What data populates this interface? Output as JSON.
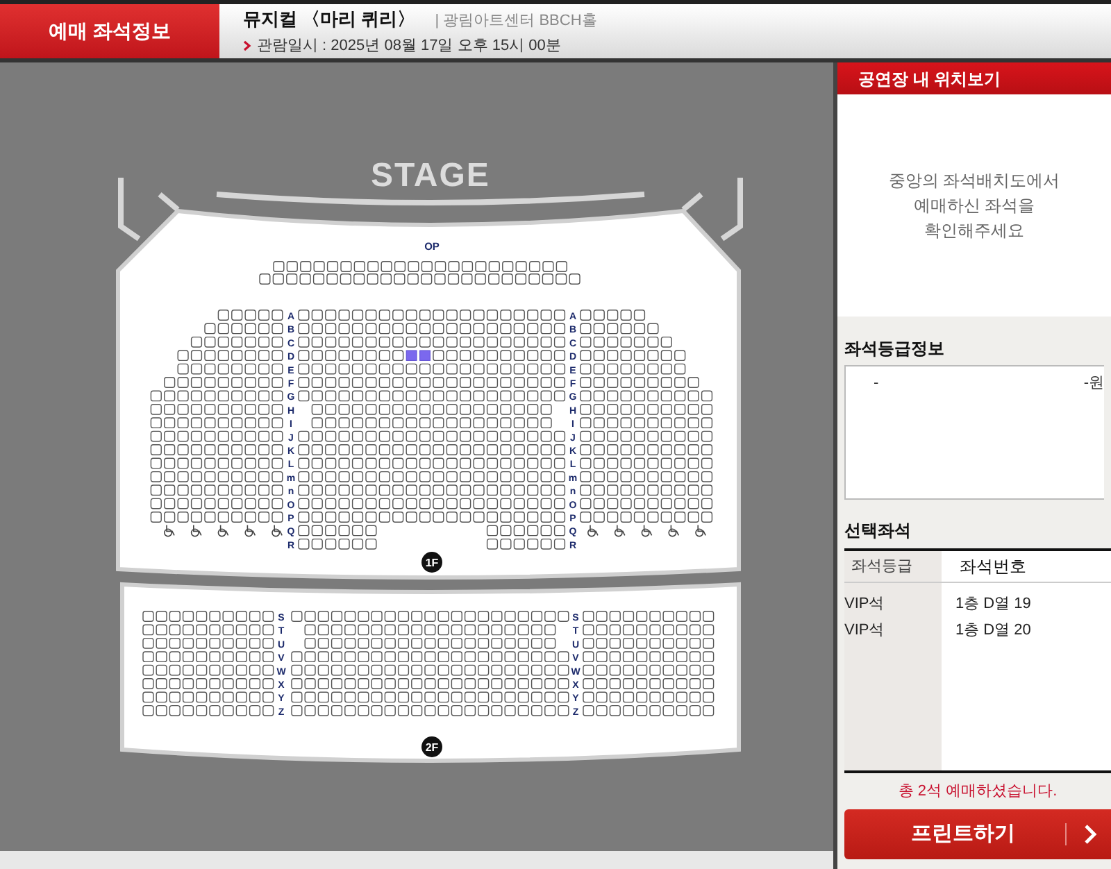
{
  "header": {
    "section_title": "예매 좌석정보",
    "show_title": "뮤지컬 〈마리 퀴리〉",
    "venue": "| 광림아트센터 BBCH홀",
    "date_label": "관람일시 : 2025년 08월 17일 오후 15시 00분"
  },
  "seat_map": {
    "stage": "STAGE",
    "op_label": "OP",
    "floors": [
      {
        "badge": "1F",
        "rows": [
          {
            "left": "A",
            "right": "A",
            "booked": false
          },
          {
            "left": "B",
            "right": "B",
            "booked": false
          },
          {
            "left": "C",
            "right": "C",
            "booked": false
          },
          {
            "left": "D",
            "right": "D",
            "booked": true
          },
          {
            "left": "E",
            "right": "E",
            "booked": false
          },
          {
            "left": "F",
            "right": "F",
            "booked": false
          },
          {
            "left": "G",
            "right": "G",
            "booked": false
          },
          {
            "left": "H",
            "right": "H",
            "booked": false
          },
          {
            "left": "I",
            "right": "I",
            "booked": false
          },
          {
            "left": "J",
            "right": "J",
            "booked": false
          },
          {
            "left": "K",
            "right": "K",
            "booked": false
          },
          {
            "left": "L",
            "right": "L",
            "booked": false
          },
          {
            "left": "m",
            "right": "m",
            "booked": false
          },
          {
            "left": "n",
            "right": "n",
            "booked": false
          },
          {
            "left": "O",
            "right": "O",
            "booked": false
          },
          {
            "left": "P",
            "right": "P",
            "booked": false
          },
          {
            "left": "Q",
            "right": "Q",
            "booked": false
          },
          {
            "left": "R",
            "right": "R",
            "booked": false
          }
        ]
      },
      {
        "badge": "2F",
        "rows": [
          {
            "left": "S",
            "right": "S"
          },
          {
            "left": "T",
            "right": "T"
          },
          {
            "left": "U",
            "right": "U"
          },
          {
            "left": "V",
            "right": "V"
          },
          {
            "left": "W",
            "right": "W"
          },
          {
            "left": "X",
            "right": "X"
          },
          {
            "left": "Y",
            "right": "Y"
          },
          {
            "left": "Z",
            "right": "Z"
          }
        ]
      }
    ]
  },
  "location_panel": {
    "title": "공연장 내 위치보기",
    "message": "중앙의 좌석배치도에서 예매하신 좌석을 확인해주세요"
  },
  "grade_info": {
    "title": "좌석등급정보",
    "rows": [
      {
        "grade": "-",
        "price": "-원"
      }
    ]
  },
  "selected_seats": {
    "title": "선택좌석",
    "columns": [
      "좌석등급",
      "좌석번호"
    ],
    "rows": [
      {
        "grade": "VIP석",
        "seat": "1층 D열 19"
      },
      {
        "grade": "VIP석",
        "seat": "1층 D열 20"
      }
    ],
    "summary": "총 2석 예매하셨습니다.",
    "print_button": "프린트하기"
  }
}
